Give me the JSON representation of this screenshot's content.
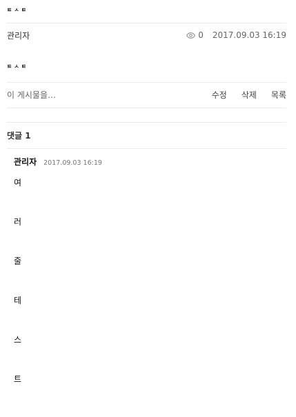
{
  "post": {
    "title": "ㅌㅅㅌ",
    "author": "관리자",
    "views": "0",
    "date": "2017.09.03 16:19",
    "body": "ㅌㅅㅌ",
    "more_text": "이 게시물을…"
  },
  "actions": {
    "edit": "수정",
    "delete": "삭제",
    "list": "목록"
  },
  "comments": {
    "header": "댓글 1",
    "items": [
      {
        "author": "관리자",
        "date": "2017.09.03 16:19",
        "lines": [
          "여",
          "러",
          "줄",
          "테",
          "스",
          "트"
        ]
      }
    ]
  },
  "icons": {
    "views": "eye-icon"
  }
}
